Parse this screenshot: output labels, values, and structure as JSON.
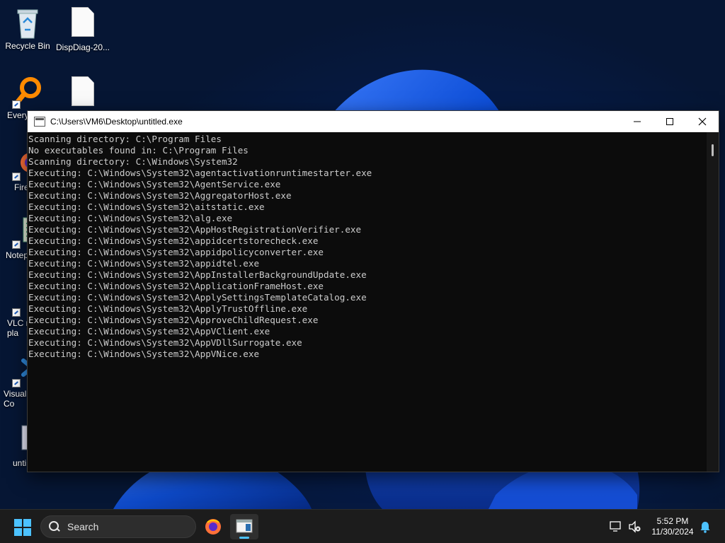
{
  "desktop": {
    "icons": [
      {
        "label": "Recycle Bin"
      },
      {
        "label": "DispDiag-20..."
      },
      {
        "label": "Every"
      },
      {
        "label": ""
      },
      {
        "label": "Fire"
      },
      {
        "label": "Notep"
      },
      {
        "label": "VLC r\npla"
      },
      {
        "label": "Visual\nCo"
      },
      {
        "label": "unti"
      }
    ]
  },
  "console": {
    "title": "C:\\Users\\VM6\\Desktop\\untitled.exe",
    "lines": [
      "Scanning directory: C:\\Program Files",
      "No executables found in: C:\\Program Files",
      "Scanning directory: C:\\Windows\\System32",
      "Executing: C:\\Windows\\System32\\agentactivationruntimestarter.exe",
      "Executing: C:\\Windows\\System32\\AgentService.exe",
      "Executing: C:\\Windows\\System32\\AggregatorHost.exe",
      "Executing: C:\\Windows\\System32\\aitstatic.exe",
      "Executing: C:\\Windows\\System32\\alg.exe",
      "Executing: C:\\Windows\\System32\\AppHostRegistrationVerifier.exe",
      "Executing: C:\\Windows\\System32\\appidcertstorecheck.exe",
      "Executing: C:\\Windows\\System32\\appidpolicyconverter.exe",
      "Executing: C:\\Windows\\System32\\appidtel.exe",
      "Executing: C:\\Windows\\System32\\AppInstallerBackgroundUpdate.exe",
      "Executing: C:\\Windows\\System32\\ApplicationFrameHost.exe",
      "Executing: C:\\Windows\\System32\\ApplySettingsTemplateCatalog.exe",
      "Executing: C:\\Windows\\System32\\ApplyTrustOffline.exe",
      "Executing: C:\\Windows\\System32\\ApproveChildRequest.exe",
      "Executing: C:\\Windows\\System32\\AppVClient.exe",
      "Executing: C:\\Windows\\System32\\AppVDllSurrogate.exe",
      "Executing: C:\\Windows\\System32\\AppVNice.exe"
    ]
  },
  "taskbar": {
    "search_placeholder": "Search",
    "clock_time": "5:52 PM",
    "clock_date": "11/30/2024"
  },
  "colors": {
    "accent": "#4cc2ff",
    "console_bg": "#0c0c0c",
    "console_text": "#cccccc",
    "taskbar_bg": "#1c1c1c"
  }
}
